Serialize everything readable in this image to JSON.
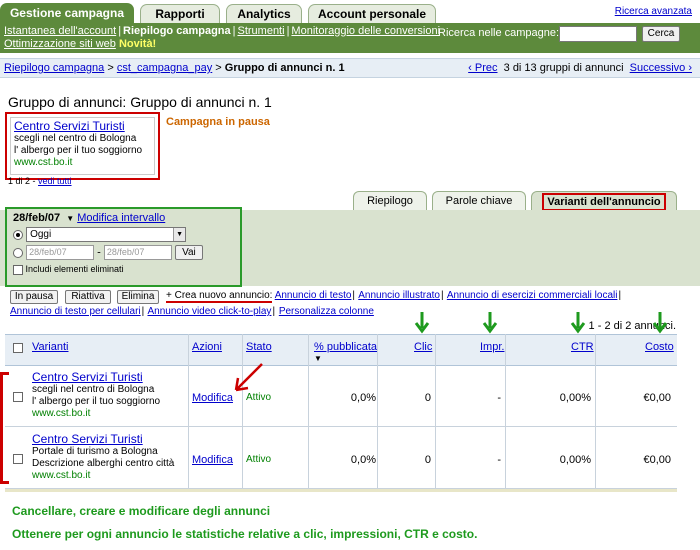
{
  "nav": {
    "tabs": [
      "Gestione campagna",
      "Rapporti",
      "Analytics",
      "Account personale"
    ],
    "advanced_search": "Ricerca avanzata"
  },
  "subnav": {
    "links": [
      "Istantanea dell'account",
      "Riepilogo campagna",
      "Strumenti",
      "Monitoraggio delle conversioni"
    ],
    "link2": "Ottimizzazione siti web",
    "new_badge": "Novità!",
    "search_label": "Ricerca nelle campagne:",
    "search_value": "",
    "search_button": "Cerca"
  },
  "breadcrumb": {
    "crumb1": "Riepilogo campagna",
    "sep": " > ",
    "crumb2": "cst_campagna_pay",
    "current": "Gruppo di annunci n. 1",
    "prev": "‹ Prec",
    "position_text": "3 di 13 gruppi di annunci",
    "next": "Successivo ›"
  },
  "page_title": "Gruppo di annunci: Gruppo di annunci n. 1",
  "ad_preview": {
    "title": "Centro Servizi Turisti",
    "line1": "scegli nel centro di Bologna",
    "line2": "l' albergo per il tuo soggiorno",
    "url": "www.cst.bo.it",
    "count": "1 di 2 - ",
    "view_all": "vedi tutti"
  },
  "status_text": "Campagna in pausa",
  "view_tabs": [
    "Riepilogo",
    "Parole chiave",
    "Varianti dell'annuncio"
  ],
  "date_range": {
    "current_date": "28/feb/07",
    "modify_link": "Modifica intervallo",
    "preset": "Oggi",
    "from_date": "28/feb/07",
    "dash": "-",
    "to_date": "28/feb/07",
    "go_button": "Vai",
    "include_deleted": "Includi elementi eliminati"
  },
  "actions": {
    "pause": "In pausa",
    "enable": "Riattiva",
    "delete": "Elimina",
    "create_label": "+ Crea nuovo annuncio:",
    "links1": [
      "Annuncio di testo",
      "Annuncio illustrato",
      "Annuncio di esercizi commerciali locali"
    ],
    "links2": [
      "Annuncio di testo per cellulari",
      "Annuncio video click-to-play",
      "Personalizza colonne"
    ],
    "count_text": "1 - 2 di 2 annunci."
  },
  "table": {
    "headers": {
      "variants": "Varianti",
      "actions": "Azioni",
      "status": "Stato",
      "pct": "% pubblicata",
      "clicks": "Clic",
      "impr": "Impr.",
      "ctr": "CTR",
      "cost": "Costo"
    },
    "sort_marker": "▼",
    "rows": [
      {
        "title": "Centro Servizi Turisti",
        "line1": "scegli nel centro di Bologna",
        "line2": "l' albergo per il tuo soggiorno",
        "url": "www.cst.bo.it",
        "action": "Modifica",
        "status": "Attivo",
        "pct": "0,0%",
        "clicks": "0",
        "impr": "-",
        "ctr": "0,00%",
        "cost": "€0,00"
      },
      {
        "title": "Centro Servizi Turisti",
        "line1": "Portale di turismo a Bologna",
        "line2": "Descrizione alberghi centro città",
        "url": "www.cst.bo.it",
        "action": "Modifica",
        "status": "Attivo",
        "pct": "0,0%",
        "clicks": "0",
        "impr": "-",
        "ctr": "0,00%",
        "cost": "€0,00"
      }
    ]
  },
  "captions": [
    "Cancellare, creare e modificare degli annunci",
    "Ottenere per ogni annuncio le statistiche relative a clic, impressioni, CTR e costo."
  ],
  "colors": {
    "brand_green": "#5d8a3c",
    "annotation_red": "#cc0000",
    "annotation_green": "#1e9a1e",
    "link_blue": "#0000cc"
  }
}
